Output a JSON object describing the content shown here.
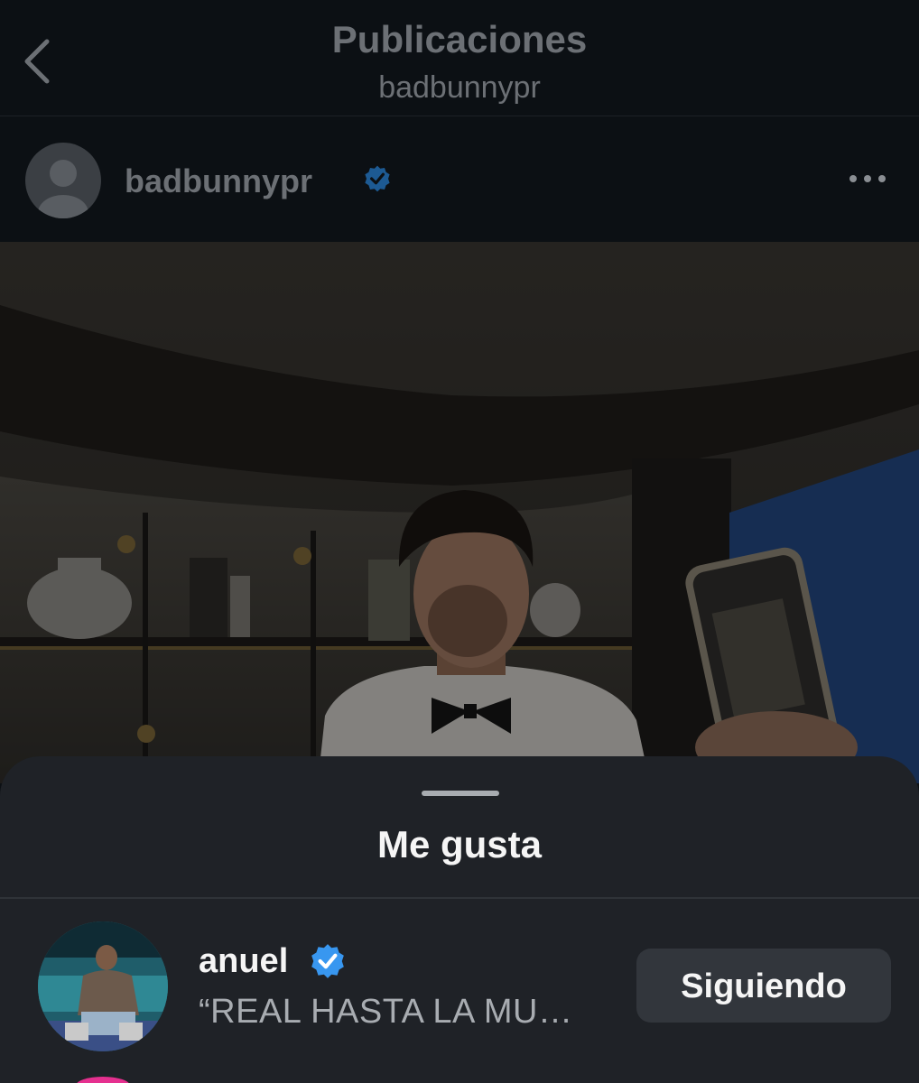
{
  "nav": {
    "title": "Publicaciones",
    "subtitle": "badbunnypr",
    "back_icon": "chevron-left-icon"
  },
  "post": {
    "username": "badbunnypr",
    "verified": true,
    "more_icon": "more-horizontal-icon"
  },
  "sheet": {
    "title": "Me gusta",
    "likes": [
      {
        "username": "anuel",
        "verified": true,
        "bio": "“REAL HASTA LA MU…",
        "button_label": "Siguiendo"
      }
    ]
  },
  "colors": {
    "background": "#0c1014",
    "sheet": "#1f2227",
    "verified_blue": "#3897f0",
    "button_bg": "#32363c"
  }
}
